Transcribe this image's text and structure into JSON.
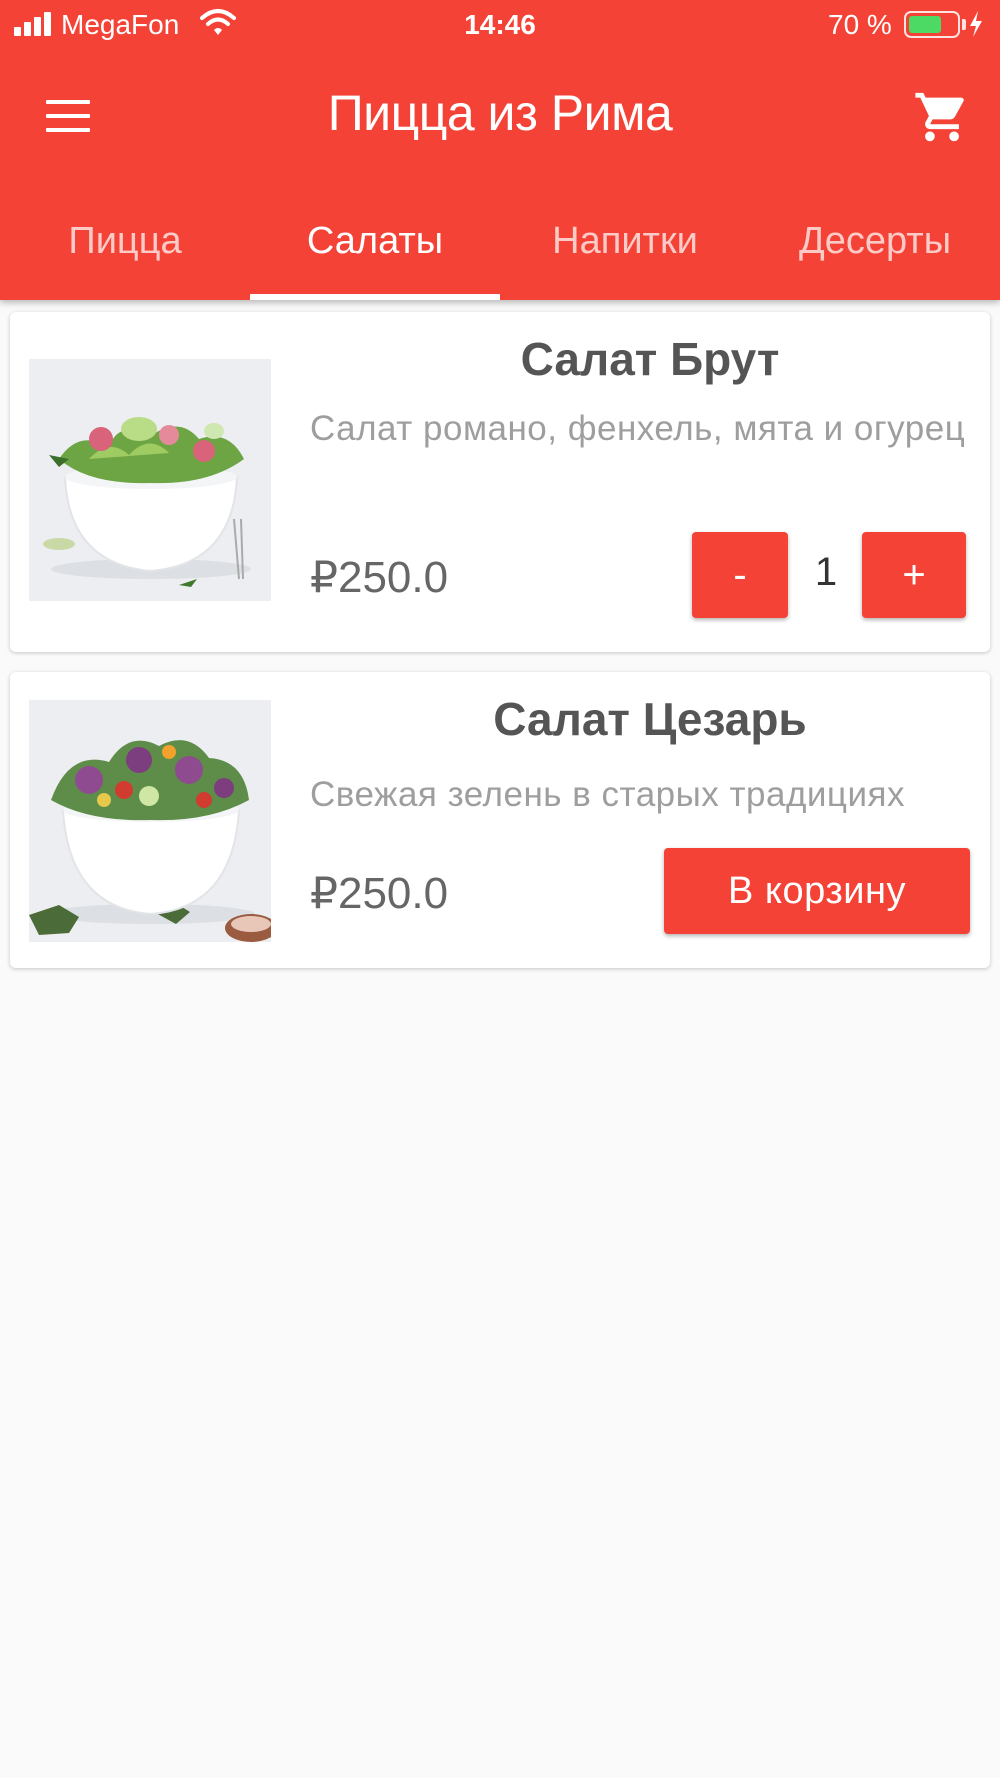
{
  "status_bar": {
    "carrier": "MegaFon",
    "time": "14:46",
    "battery_percent": "70 %",
    "battery_level": 0.7,
    "battery_color": "#4cd964"
  },
  "toolbar": {
    "title": "Пицца из Рима",
    "menu_icon": "menu-icon",
    "cart_icon": "cart-icon",
    "background_color": "#f44336"
  },
  "tabs": [
    {
      "label": "Пицца",
      "active": false
    },
    {
      "label": "Салаты",
      "active": true
    },
    {
      "label": "Напитки",
      "active": false
    },
    {
      "label": "Десерты",
      "active": false
    }
  ],
  "products": [
    {
      "name": "Салат Брут",
      "description": "Салат романо, фенхель, мята и огурец",
      "price": "₽250.0",
      "quantity": "1",
      "minus_label": "-",
      "plus_label": "+"
    },
    {
      "name": "Салат Цезарь",
      "description": "Свежая зелень в старых традициях",
      "price": "₽250.0",
      "add_to_cart_label": "В корзину"
    }
  ]
}
